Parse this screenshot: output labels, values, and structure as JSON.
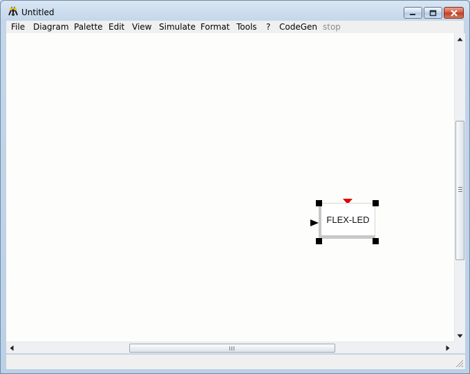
{
  "window": {
    "title": "Untitled"
  },
  "menu": {
    "items": [
      "File",
      "Diagram",
      "Palette",
      "Edit",
      "View",
      "Simulate",
      "Format",
      "Tools",
      "?",
      "CodeGen"
    ],
    "disabled_item": "stop"
  },
  "diagram": {
    "blocks": [
      {
        "label": "FLEX-LED"
      }
    ]
  },
  "colors": {
    "event_port": "#e00000",
    "canvas": "#fdfdfb"
  },
  "icons": [
    "scilab-app-icon",
    "minimize-icon",
    "maximize-icon",
    "close-icon",
    "scroll-up-icon",
    "scroll-down-icon",
    "scroll-left-icon",
    "scroll-right-icon",
    "resize-grip-icon"
  ]
}
